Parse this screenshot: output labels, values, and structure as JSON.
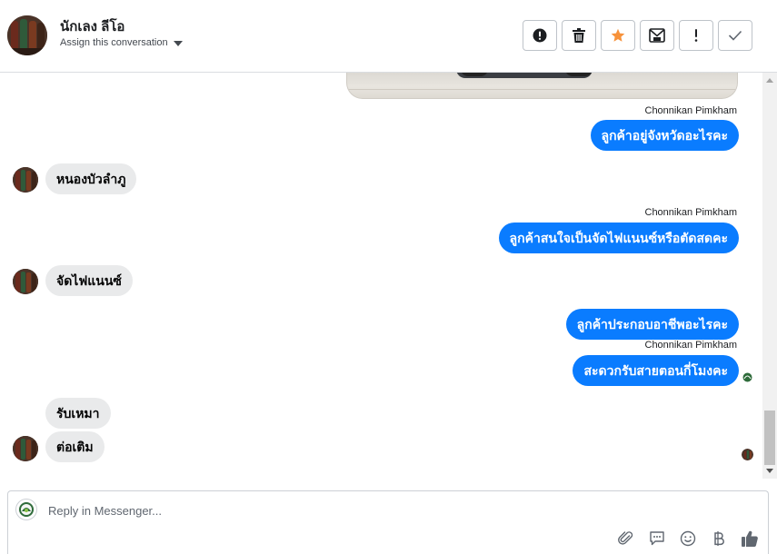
{
  "header": {
    "contact_name": "นักเลง ลีโอ",
    "assign_label": "Assign this conversation"
  },
  "actions": [
    {
      "icon": "alert-circle-icon"
    },
    {
      "icon": "trash-icon"
    },
    {
      "icon": "star-icon",
      "color": "#f7923b"
    },
    {
      "icon": "mark-unread-icon"
    },
    {
      "icon": "exclamation-icon"
    },
    {
      "icon": "check-icon"
    }
  ],
  "messages": [
    {
      "sender": "Chonnikan Pimkham",
      "text": "ลูกค้าอยู่จังหวัดอะไรคะ"
    },
    {
      "text": "หนองบัวลำภู"
    },
    {
      "sender": "Chonnikan Pimkham",
      "text": "ลูกค้าสนใจเป็นจัดไฟแนนซ์หรือตัดสดคะ"
    },
    {
      "text": "จัดไฟแนนซ์"
    },
    {
      "text": "ลูกค้าประกอบอาชีพอะไรคะ"
    },
    {
      "sender": "Chonnikan Pimkham",
      "text": "สะดวกรับสายตอนกี่โมงคะ"
    },
    {
      "text": "รับเหมา"
    },
    {
      "text": "ต่อเติม"
    }
  ],
  "composer": {
    "placeholder": "Reply in Messenger..."
  },
  "colors": {
    "outgoing_bubble": "#0a7cff",
    "incoming_bubble": "#e9eaeb",
    "star": "#f7923b"
  }
}
